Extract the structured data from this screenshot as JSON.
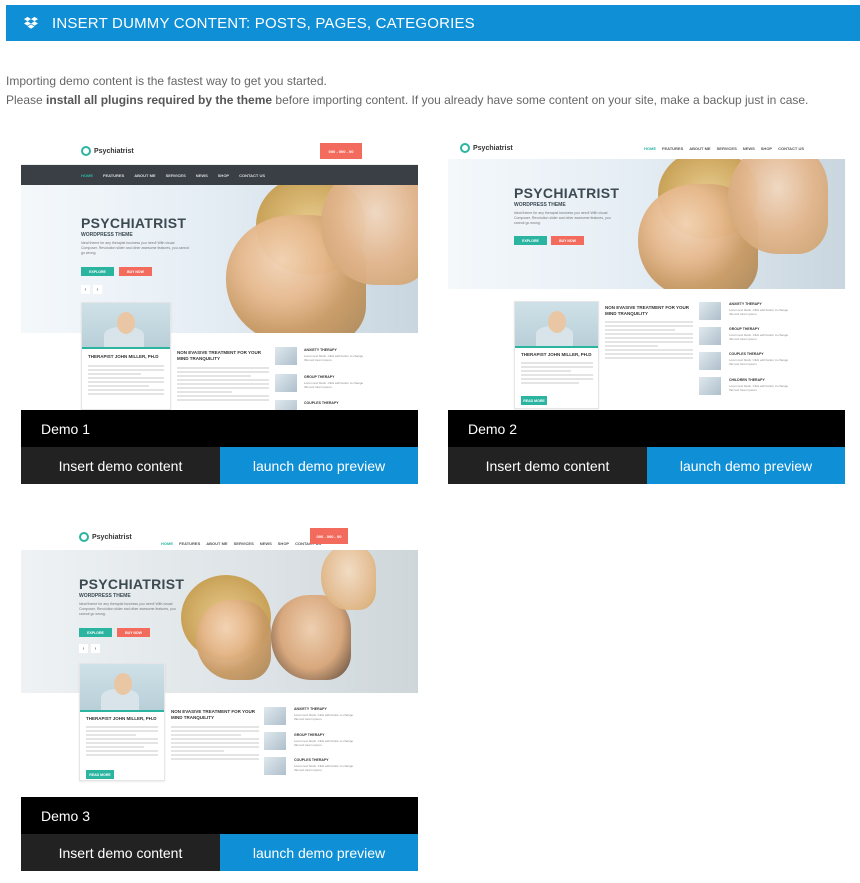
{
  "header": {
    "icon": "dropbox-icon",
    "title": "INSERT DUMMY CONTENT: POSTS, PAGES, CATEGORIES",
    "color": "#0e8fd6"
  },
  "intro": {
    "line1": "Importing demo content is the fastest way to get you started.",
    "line2_prefix": "Please ",
    "line2_bold": "install all plugins required by the theme",
    "line2_suffix": " before importing content. If you already have some content on your site, make a backup just in case."
  },
  "demos": [
    {
      "label": "Demo 1",
      "insert_label": "Insert demo content",
      "preview_label": "launch demo preview",
      "site": {
        "logo": "Psychiatrist",
        "nav": [
          "HOME",
          "FEATURES",
          "ABOUT ME",
          "SERVICES",
          "NEWS",
          "SHOP",
          "CONTACT US"
        ],
        "phone": "000 - 000 - 00",
        "hero_title": "PSYCHIATRIST",
        "hero_subtitle": "WORDPRESS THEME",
        "hero_text": "Ideal theme for any therapist business you need! With visual Composer, Revolution slider and other awesome features, you cannot go wrong.",
        "explore": "EXPLORE",
        "buy": "BUY NOW",
        "therapist": "THERAPIST JOHN MILLER, PH.D",
        "section_title": "NON EVASIVE TREATMENT FOR YOUR MIND TRANQUILITY",
        "services": [
          "ANXIETY THERAPY",
          "GROUP THERAPY",
          "COUPLES THERAPY"
        ]
      }
    },
    {
      "label": "Demo 2",
      "insert_label": "Insert demo content",
      "preview_label": "launch demo preview",
      "site": {
        "logo": "Psychiatrist",
        "nav": [
          "HOME",
          "FEATURES",
          "ABOUT ME",
          "SERVICES",
          "NEWS",
          "SHOP",
          "CONTACT US"
        ],
        "hero_title": "PSYCHIATRIST",
        "hero_subtitle": "WORDPRESS THEME",
        "hero_text": "Ideal theme for any therapist business you need! With visual Composer, Revolution slider and other awesome features, you cannot go wrong.",
        "explore": "EXPLORE",
        "buy": "BUY NOW",
        "therapist": "THERAPIST JOHN MILLER, PH.D",
        "read_more": "READ MORE",
        "section_title": "NON EVASIVE TREATMENT FOR YOUR MIND TRANQUILITY",
        "services": [
          "ANXIETY THERAPY",
          "GROUP THERAPY",
          "COUPLES THERAPY",
          "CHILDREN THERAPY"
        ]
      }
    },
    {
      "label": "Demo 3",
      "insert_label": "Insert demo content",
      "preview_label": "launch demo preview",
      "site": {
        "logo": "Psychiatrist",
        "nav": [
          "HOME",
          "FEATURES",
          "ABOUT ME",
          "SERVICES",
          "NEWS",
          "SHOP",
          "CONTACT US"
        ],
        "phone": "000 - 000 - 00",
        "hero_title": "PSYCHIATRIST",
        "hero_subtitle": "WORDPRESS THEME",
        "hero_text": "Ideal theme for any therapist business you need! With visual Composer, Revolution slider and other awesome features, you cannot go wrong.",
        "explore": "EXPLORE",
        "buy": "BUY NOW",
        "therapist": "THERAPIST JOHN MILLER, PH.D",
        "read_more": "READ MORE",
        "section_title": "NON EVASIVE TREATMENT FOR YOUR MIND TRANQUILITY",
        "services": [
          "ANXIETY THERAPY",
          "GROUP THERAPY",
          "COUPLES THERAPY"
        ]
      }
    }
  ]
}
